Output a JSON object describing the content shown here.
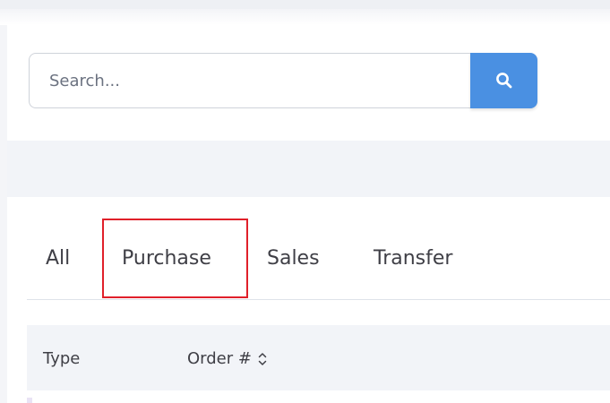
{
  "search": {
    "placeholder": "Search...",
    "button_icon": "search-icon",
    "button_color": "#4a90e2"
  },
  "tabs": [
    {
      "label": "All"
    },
    {
      "label": "Purchase",
      "highlighted": true
    },
    {
      "label": "Sales"
    },
    {
      "label": "Transfer"
    }
  ],
  "table": {
    "columns": [
      {
        "label": "Type"
      },
      {
        "label": "Order #",
        "sort_icon": "sort-toggle-icon"
      }
    ]
  },
  "colors": {
    "highlight_border": "#e0202a",
    "header_band": "#f2f4f8"
  }
}
